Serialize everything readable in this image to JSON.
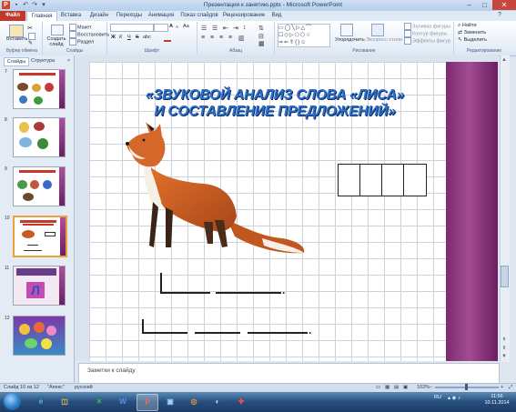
{
  "window": {
    "title": "Презентация к занятию.pptx - Microsoft PowerPoint",
    "app_letter": "P",
    "controls": {
      "minimize": "–",
      "maximize": "□",
      "close": "✕"
    }
  },
  "tabs": [
    "Файл",
    "Главная",
    "Вставка",
    "Дизайн",
    "Переходы",
    "Анимация",
    "Показ слайдов",
    "Рецензирование",
    "Вид"
  ],
  "ribbon": {
    "clipboard": {
      "paste": "Вставить",
      "label": "Буфер обмена"
    },
    "slides": {
      "create": "Создать слайд",
      "layout": "Макет",
      "reset": "Восстановить",
      "section": "Раздел",
      "label": "Слайды"
    },
    "font": {
      "label": "Шрифт",
      "bold": "Ж",
      "italic": "К",
      "underline": "Ч",
      "strike": "S",
      "abc": "abc",
      "size_up": "A",
      "size_down": "A",
      "clear": "Аа"
    },
    "paragraph": {
      "label": "Абзац"
    },
    "drawing": {
      "arrange": "Упорядочить",
      "quick_styles": "Экспресс-стили",
      "fill": "Заливка фигуры",
      "outline": "Контур фигуры",
      "effects": "Эффекты фигур",
      "label": "Рисование"
    },
    "editing": {
      "find": "Найти",
      "replace": "Заменить",
      "select": "Выделить",
      "label": "Редактирование"
    }
  },
  "left_panel": {
    "tabs": {
      "slides": "Слайды",
      "outline": "Структура",
      "close": "×"
    },
    "thumbnails": [
      {
        "number": "7"
      },
      {
        "number": "8"
      },
      {
        "number": "9"
      },
      {
        "number": "10",
        "selected": true
      },
      {
        "number": "11",
        "letter": "Л"
      },
      {
        "number": "12"
      }
    ]
  },
  "slide": {
    "title_line1": "«ЗВУКОВОЙ АНАЛИЗ СЛОВА «ЛИСА»",
    "title_line2": "И СОСТАВЛЕНИЕ ПРЕДЛОЖЕНИЙ»",
    "sentence_end": "."
  },
  "notes": {
    "placeholder": "Заметки к слайду"
  },
  "status": {
    "slide_of": "Слайд 10 из 12",
    "theme": "\"Апекс\"",
    "language": "русский",
    "zoom": "102%",
    "zoom_minus": "–",
    "zoom_plus": "+"
  },
  "taskbar": {
    "apps": [
      "e",
      "◫",
      "✕",
      "W",
      "P",
      "▣",
      "◎",
      "◐",
      "✚"
    ],
    "tray_lang": "RU",
    "time": "11:56",
    "date": "10.11.2014"
  },
  "colors": {
    "title_blue": "#2e6fc8",
    "stripe_purple": "#8c3380",
    "file_tab_red": "#c0392b"
  }
}
